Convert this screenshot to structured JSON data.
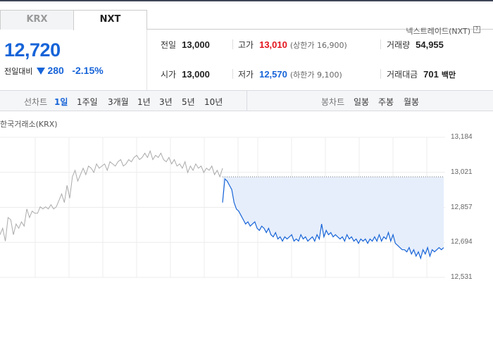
{
  "tabs": [
    {
      "label": "KRX",
      "active": false
    },
    {
      "label": "NXT",
      "active": true
    }
  ],
  "exchange_label": "넥스트레이드(NXT)",
  "help_icon": "?",
  "price": "12,720",
  "change": {
    "label": "전일대비",
    "direction": "down",
    "amount": "280",
    "percent": "-2.15%"
  },
  "stats": {
    "prev_close": {
      "label": "전일",
      "value": "13,000"
    },
    "high": {
      "label": "고가",
      "value": "13,010",
      "sub": "(상한가 16,900)"
    },
    "volume": {
      "label": "거래량",
      "value": "54,955"
    },
    "open": {
      "label": "시가",
      "value": "13,000"
    },
    "low": {
      "label": "저가",
      "value": "12,570",
      "sub": "(하한가 9,100)"
    },
    "amount": {
      "label": "거래대금",
      "value": "701",
      "unit": "백만"
    }
  },
  "toolbar": {
    "line_chart_label": "선차트",
    "periods": [
      "1일",
      "1주일",
      "3개월",
      "1년",
      "3년",
      "5년",
      "10년"
    ],
    "selected_period": "1일",
    "candle_label": "봉차트",
    "candle_periods": [
      "일봉",
      "주봉",
      "월봉"
    ]
  },
  "chart_label": "한국거래소(KRX)",
  "chart_data": {
    "type": "line",
    "ylim": [
      12531,
      13184
    ],
    "yticks": [
      "13,184",
      "13,021",
      "12,857",
      "12,694",
      "12,531"
    ],
    "reference_value": 13000,
    "series": [
      {
        "values": [
          12730,
          12760,
          12700,
          12810,
          12800,
          12730,
          12780,
          12760,
          12790,
          12770,
          12850,
          12810,
          12840,
          12830,
          12830,
          12860,
          12850,
          12860,
          12850,
          12870,
          12850,
          12860,
          12890,
          12920,
          12880,
          12960,
          12900,
          13000,
          13030,
          12980,
          13010,
          13040,
          13010,
          13050,
          13040,
          13020,
          13060,
          13040,
          13050,
          13060,
          13030,
          13070,
          13060,
          13050,
          13070,
          13080,
          13050,
          13060,
          13080,
          13070,
          13090,
          13100,
          13080,
          13090,
          13110,
          13090,
          13120,
          13080,
          13100,
          13090,
          13110,
          13080,
          13070,
          13090,
          13060,
          13080,
          13050,
          13060,
          13040,
          13070,
          13020,
          13050,
          13030,
          13060,
          13040,
          13050,
          13020,
          13040,
          13030,
          13050,
          13010,
          13030,
          13000,
          13040
        ]
      },
      {
        "values": [
          12880,
          12990,
          12980,
          12960,
          12940,
          12880,
          12850,
          12840,
          12820,
          12800,
          12780,
          12790,
          12770,
          12780,
          12790,
          12760,
          12750,
          12770,
          12760,
          12740,
          12760,
          12730,
          12720,
          12740,
          12710,
          12720,
          12700,
          12720,
          12710,
          12720,
          12730,
          12700,
          12710,
          12700,
          12730,
          12710,
          12720,
          12700,
          12710,
          12720,
          12700,
          12730,
          12710,
          12780,
          12720,
          12750,
          12730,
          12740,
          12720,
          12730,
          12720,
          12710,
          12720,
          12700,
          12730,
          12710,
          12720,
          12700,
          12710,
          12690,
          12710,
          12700,
          12710,
          12690,
          12710,
          12700,
          12720,
          12700,
          12730,
          12700,
          12720,
          12710,
          12740,
          12700,
          12730,
          12690,
          12680,
          12670,
          12660,
          12660,
          12650,
          12670,
          12640,
          12660,
          12630,
          12650,
          12620,
          12660,
          12640,
          12670,
          12630,
          12660,
          12650,
          12660,
          12670,
          12660,
          12670
        ]
      }
    ]
  },
  "colors": {
    "accent": "#1764d8",
    "down": "#1764d8",
    "up": "#e3141c",
    "fill": "#e6eefb"
  }
}
